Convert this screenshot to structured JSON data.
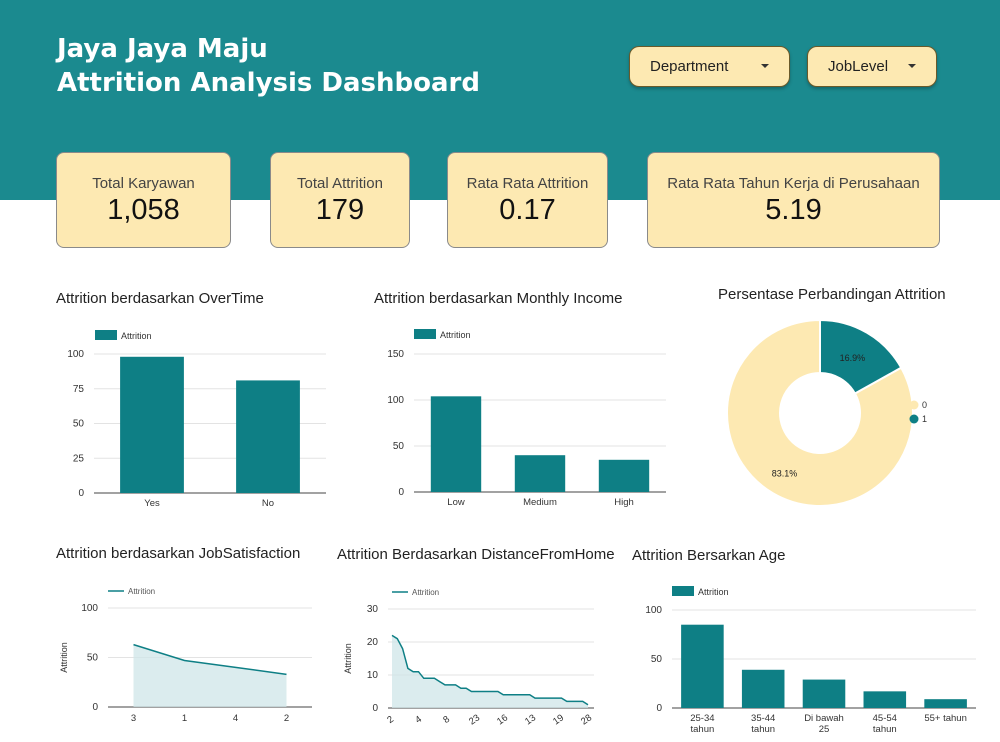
{
  "header": {
    "title_line1": "Jaya Jaya Maju",
    "title_line2": "Attrition Analysis Dashboard",
    "filters": [
      {
        "label": "Department"
      },
      {
        "label": "JobLevel"
      }
    ]
  },
  "kpis": [
    {
      "label": "Total Karyawan",
      "value": "1,058"
    },
    {
      "label": "Total Attrition",
      "value": "179"
    },
    {
      "label": "Rata Rata Attrition",
      "value": "0.17"
    },
    {
      "label": "Rata Rata Tahun Kerja di Perusahaan",
      "value": "5.19"
    }
  ],
  "colors": {
    "teal": "#1b8a8f",
    "bar": "#0e7f85",
    "cream": "#fde9b2",
    "area_fill": "#cfe6e8"
  },
  "chart_data": [
    {
      "id": "overtime",
      "type": "bar",
      "title": "Attrition berdasarkan OverTime",
      "legend": "Attrition",
      "categories": [
        "Yes",
        "No"
      ],
      "values": [
        98,
        81
      ],
      "yticks": [
        "0",
        "25",
        "50",
        "75",
        "100"
      ],
      "ylim": [
        0,
        100
      ]
    },
    {
      "id": "income",
      "type": "bar",
      "title": "Attrition berdasarkan Monthly Income",
      "legend": "Attrition",
      "categories": [
        "Low",
        "Medium",
        "High"
      ],
      "values": [
        104,
        40,
        35
      ],
      "yticks": [
        "0",
        "50",
        "100",
        "150"
      ],
      "ylim": [
        0,
        150
      ]
    },
    {
      "id": "pie",
      "type": "pie",
      "title": "Persentase Perbandingan Attrition",
      "labels": [
        "0",
        "1"
      ],
      "values": [
        83.1,
        16.9
      ],
      "value_labels": [
        "83.1%",
        "16.9%"
      ]
    },
    {
      "id": "jobsat",
      "type": "area",
      "title": "Attrition berdasarkan JobSatisfaction",
      "legend": "Attrition",
      "ylabel": "Attrition",
      "categories": [
        "3",
        "1",
        "4",
        "2"
      ],
      "values": [
        63,
        47,
        40,
        33
      ],
      "yticks": [
        "0",
        "50",
        "100"
      ],
      "ylim": [
        0,
        100
      ]
    },
    {
      "id": "distance",
      "type": "area",
      "title": "Attrition Berdasarkan DistanceFromHome",
      "legend": "Attrition",
      "ylabel": "Attrition",
      "xticks": [
        "2",
        "4",
        "8",
        "23",
        "16",
        "13",
        "19",
        "28"
      ],
      "values": [
        22,
        21,
        18,
        12,
        11,
        11,
        9,
        9,
        9,
        8,
        7,
        7,
        7,
        6,
        6,
        5,
        5,
        5,
        5,
        5,
        5,
        4,
        4,
        4,
        4,
        4,
        4,
        3,
        3,
        3,
        3,
        3,
        3,
        2,
        2,
        2,
        2,
        1
      ],
      "yticks": [
        "0",
        "10",
        "20",
        "30"
      ],
      "ylim": [
        0,
        30
      ]
    },
    {
      "id": "age",
      "type": "bar",
      "title": "Attrition Bersarkan Age",
      "legend": "Attrition",
      "categories": [
        [
          "25-34",
          "tahun"
        ],
        [
          "35-44",
          "tahun"
        ],
        [
          "Di bawah",
          "25"
        ],
        [
          "45-54",
          "tahun"
        ],
        [
          "55+ tahun"
        ]
      ],
      "values": [
        85,
        39,
        29,
        17,
        9
      ],
      "yticks": [
        "0",
        "50",
        "100"
      ],
      "ylim": [
        0,
        100
      ]
    }
  ]
}
